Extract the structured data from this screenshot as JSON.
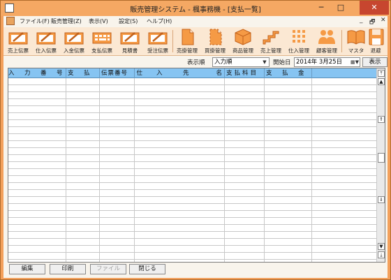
{
  "window": {
    "title": "販売管理システム - 楓事務機 - [支払一覧]",
    "min_glyph": "─",
    "max_glyph": "□",
    "close_glyph": "✕"
  },
  "menu": {
    "items": [
      "ファイル(F)",
      "販売管理(Z)",
      "表示(V)",
      "設定(S)",
      "ヘルプ(H)"
    ],
    "mdi_controls": [
      "_",
      "🗗",
      "✕"
    ]
  },
  "toolbar": {
    "buttons": [
      {
        "label": "売上伝票",
        "icon": "slip-icon"
      },
      {
        "label": "仕入伝票",
        "icon": "slip-icon"
      },
      {
        "label": "入金伝票",
        "icon": "slip-icon"
      },
      {
        "label": "支払伝票",
        "icon": "keyboard-icon"
      },
      {
        "label": "見積書",
        "icon": "slip-icon"
      },
      {
        "label": "受注伝票",
        "icon": "slip-icon"
      },
      {
        "label": "売掛管理",
        "icon": "document-icon"
      },
      {
        "label": "買掛管理",
        "icon": "document-dashed-icon"
      },
      {
        "label": "商品管理",
        "icon": "box-icon"
      },
      {
        "label": "売上管理",
        "icon": "stairs-icon"
      },
      {
        "label": "仕入管理",
        "icon": "grid-icon"
      },
      {
        "label": "顧客管理",
        "icon": "people-icon"
      },
      {
        "label": "マスタ",
        "icon": "book-icon"
      },
      {
        "label": "退避",
        "icon": "floppy-icon"
      }
    ]
  },
  "filter": {
    "sort_label": "表示順",
    "sort_value": "入力順",
    "date_label": "開始日",
    "date_value": "2014年  3月25日",
    "show_button": "表示"
  },
  "grid": {
    "columns": [
      "入　力　番　号",
      "支　払　日",
      "伝票番号",
      "仕　　入　　　先　　　　名",
      "支払科目",
      "支　払　金　額"
    ]
  },
  "footer": {
    "buttons": [
      "編集",
      "印刷",
      "ファイル",
      "閉じる"
    ]
  },
  "colors": {
    "accent": "#f3a05b",
    "header_blue": "#86c4f2",
    "toolbar_bg": "#fbe8d3"
  }
}
